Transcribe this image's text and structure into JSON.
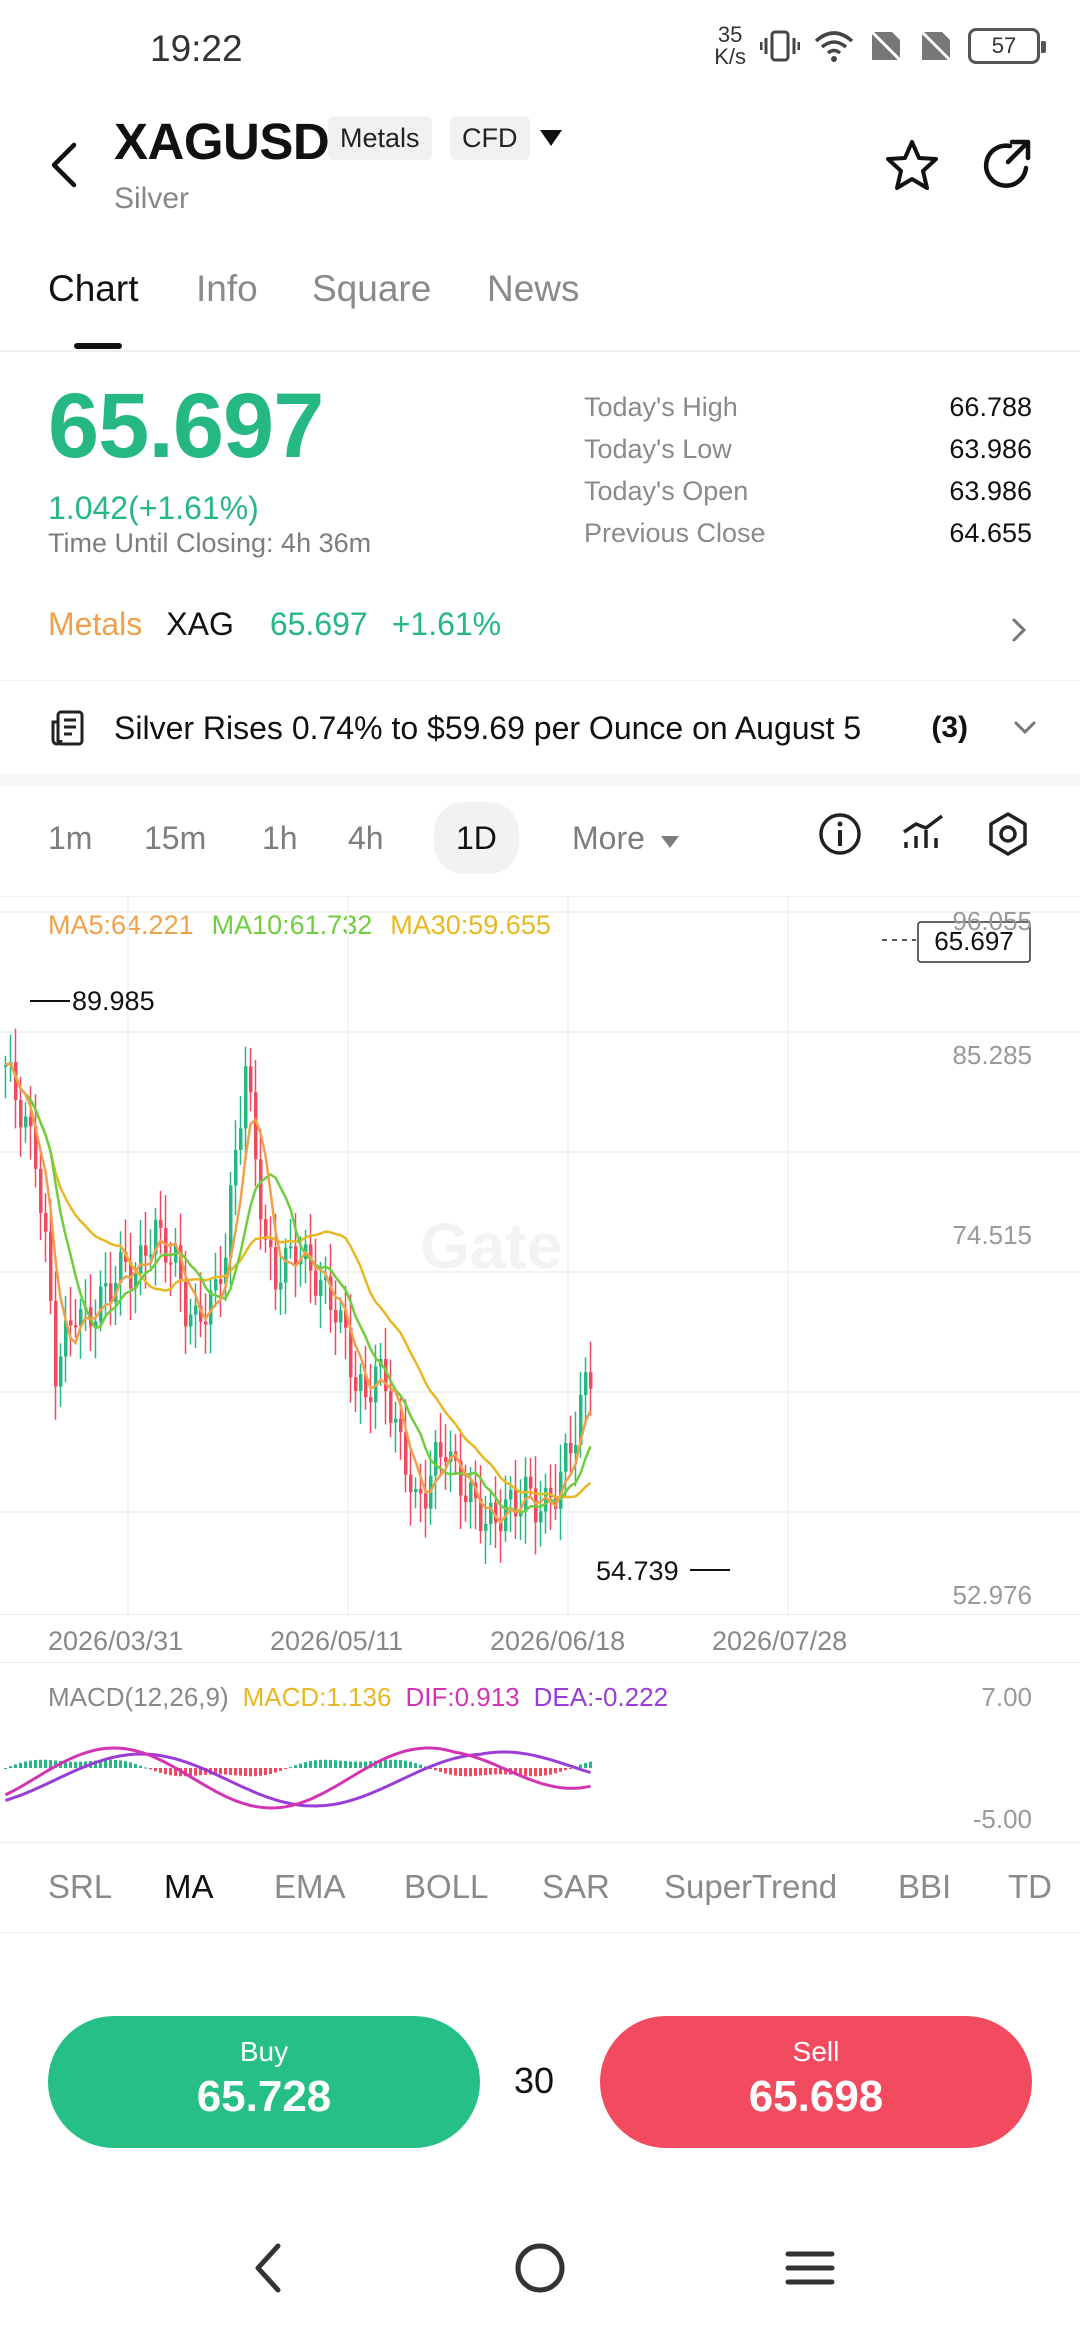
{
  "status_bar": {
    "time": "19:22",
    "net_speed_top": "35",
    "net_speed_bottom": "K/s",
    "battery": "57"
  },
  "header": {
    "symbol": "XAGUSD",
    "tag_category": "Metals",
    "tag_type": "CFD",
    "name": "Silver"
  },
  "tabs": [
    "Chart",
    "Info",
    "Square",
    "News"
  ],
  "price": {
    "last": "65.697",
    "change": "1.042(+1.61%)",
    "closing": "Time Until Closing: 4h 36m",
    "stats": [
      {
        "label": "Today's High",
        "value": "66.788"
      },
      {
        "label": "Today's Low",
        "value": "63.986"
      },
      {
        "label": "Today's Open",
        "value": "63.986"
      },
      {
        "label": "Previous Close",
        "value": "64.655"
      }
    ]
  },
  "metals_row": {
    "category": "Metals",
    "symbol": "XAG",
    "price": "65.697",
    "change": "+1.61%"
  },
  "news": {
    "headline": "Silver Rises 0.74% to $59.69 per Ounce on August 5",
    "count": "(3)"
  },
  "timeframes": {
    "items": [
      "1m",
      "15m",
      "1h",
      "4h",
      "1D"
    ],
    "more": "More",
    "active": "1D"
  },
  "chart": {
    "ma5": "MA5:64.221",
    "ma10": "MA10:61.732",
    "ma30": "MA30:59.655",
    "y_labels": [
      "96.055",
      "85.285",
      "74.515",
      "52.976"
    ],
    "dates": [
      "2026/03/31",
      "2026/05/11",
      "2026/06/18",
      "2026/07/28"
    ],
    "high_marker": "89.985",
    "low_marker": "54.739",
    "current_tag": "65.697",
    "watermark": "Gate",
    "macd_name": "MACD(12,26,9)",
    "macd_value": "MACD:1.136",
    "dif_value": "DIF:0.913",
    "dea_value": "DEA:-0.222",
    "macd_top": "7.00",
    "macd_bottom": "-5.00"
  },
  "indicators": {
    "items": [
      "SRL",
      "MA",
      "EMA",
      "BOLL",
      "SAR",
      "SuperTrend",
      "BBI",
      "TD"
    ],
    "active": "MA"
  },
  "trade": {
    "buy_label": "Buy",
    "buy_price": "65.728",
    "quantity": "30",
    "sell_label": "Sell",
    "sell_price": "65.698"
  },
  "colors": {
    "up": "#26b883",
    "down": "#f04a5e",
    "ma5": "#f0a04b",
    "ma10": "#6fce3e",
    "ma30": "#e8b824",
    "macd_dif": "#d234b3",
    "macd_dea": "#9a3cd6"
  }
}
